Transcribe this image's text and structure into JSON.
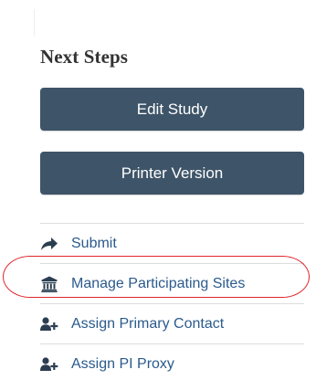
{
  "panel": {
    "heading": "Next Steps",
    "buttons": [
      {
        "label": "Edit Study"
      },
      {
        "label": "Printer Version"
      }
    ],
    "actions": [
      {
        "label": "Submit",
        "icon": "share-arrow-icon"
      },
      {
        "label": "Manage Participating Sites",
        "icon": "institution-icon"
      },
      {
        "label": "Assign Primary Contact",
        "icon": "add-user-icon"
      },
      {
        "label": "Assign PI Proxy",
        "icon": "add-user-icon"
      }
    ]
  },
  "colors": {
    "button_bg": "#3e5468",
    "link": "#2a5a8c",
    "highlight": "#e0262d"
  }
}
